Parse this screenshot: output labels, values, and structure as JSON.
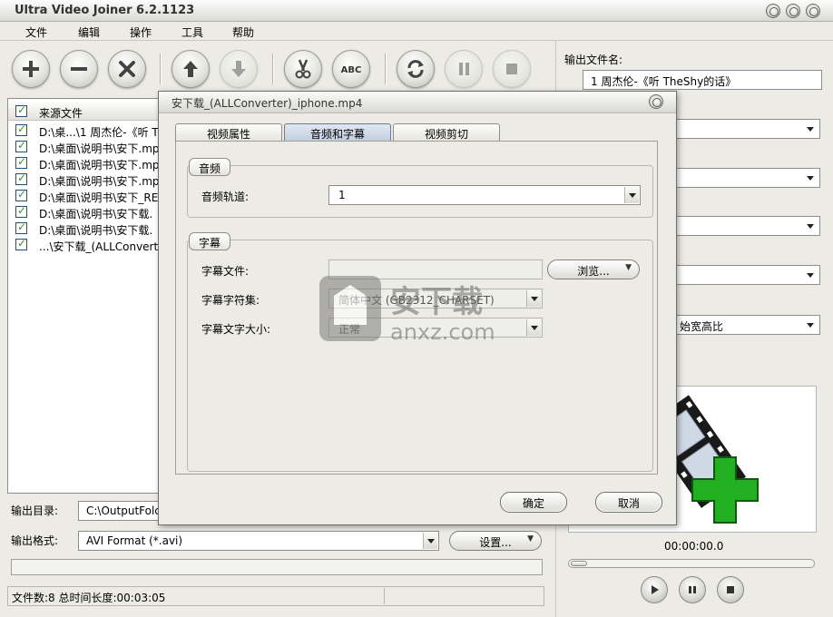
{
  "window": {
    "title": "Ultra Video Joiner 6.2.1123"
  },
  "menu": [
    "文件",
    "编辑",
    "操作",
    "工具",
    "帮助"
  ],
  "toolbar_icons": [
    "add-icon",
    "remove-icon",
    "clear-icon",
    "move-up-icon",
    "move-down-icon",
    "cut-icon",
    "abc-icon",
    "convert-icon",
    "pause-icon",
    "stop-icon"
  ],
  "list": {
    "header": "来源文件",
    "rows": [
      "D:\\桌...\\1 周杰伦-《听 T",
      "D:\\桌面\\说明书\\安下.mp",
      "D:\\桌面\\说明书\\安下.mp",
      "D:\\桌面\\说明书\\安下.mp",
      "D:\\桌面\\说明书\\安下_RE",
      "D:\\桌面\\说明书\\安下载.",
      "D:\\桌面\\说明书\\安下载.",
      "...\\安下载_(ALLConvert"
    ]
  },
  "output": {
    "dir_label": "输出目录:",
    "dir_value": "C:\\OutputFolc",
    "format_label": "输出格式:",
    "format_value": "AVI Format (*.avi)",
    "settings_label": "设置..."
  },
  "status": {
    "text": "文件数:8  总时间长度:00:03:05"
  },
  "right": {
    "output_name_label": "输出文件名:",
    "output_name_value": "1 周杰伦-《听 TheShy的话》",
    "aspect_text": "始宽高比",
    "time": "00:00:00.0"
  },
  "dialog": {
    "title": "安下载_(ALLConverter)_iphone.mp4",
    "tabs": [
      "视频属性",
      "音频和字幕",
      "视频剪切"
    ],
    "audio": {
      "group_title": "音频",
      "track_label": "音频轨道:",
      "track_value": "1"
    },
    "subtitle": {
      "group_title": "字幕",
      "file_label": "字幕文件:",
      "file_value": "",
      "browse_label": "浏览...",
      "charset_label": "字幕字符集:",
      "charset_value": "简体中文 (GB2312_CHARSET)",
      "size_label": "字幕文字大小:",
      "size_value": "正常"
    },
    "ok_label": "确定",
    "cancel_label": "取消"
  },
  "watermark": {
    "cn": "安下载",
    "en": "anxz.com"
  }
}
